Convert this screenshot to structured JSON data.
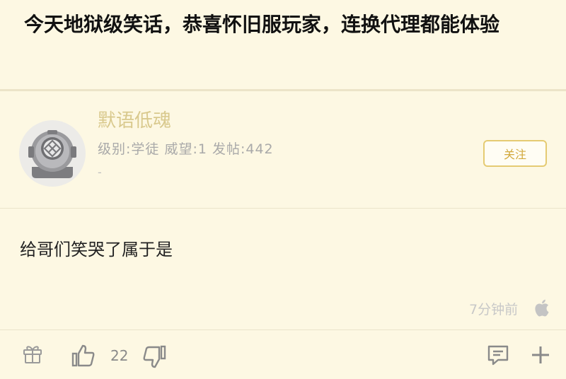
{
  "post": {
    "title": "今天地狱级笑话，恭喜怀旧服玩家，连换代理都能体验"
  },
  "author": {
    "username": "默语低魂",
    "meta": "级别:学徒 威望:1 发帖:442",
    "extra": "-",
    "follow_label": "关注",
    "avatar_icon": "diver-helmet-avatar"
  },
  "reply": {
    "content": "给哥们笑哭了属于是",
    "time": "7分钟前",
    "device_icon": "apple-icon"
  },
  "actions": {
    "like_count": "22",
    "icons": [
      "gift-icon",
      "thumbs-up-icon",
      "thumbs-down-icon",
      "comment-icon",
      "plus-icon"
    ]
  },
  "colors": {
    "background": "#fdf8e3",
    "username": "#d9c98d",
    "follow_border": "#e5cb73",
    "follow_text": "#d2a93c"
  }
}
